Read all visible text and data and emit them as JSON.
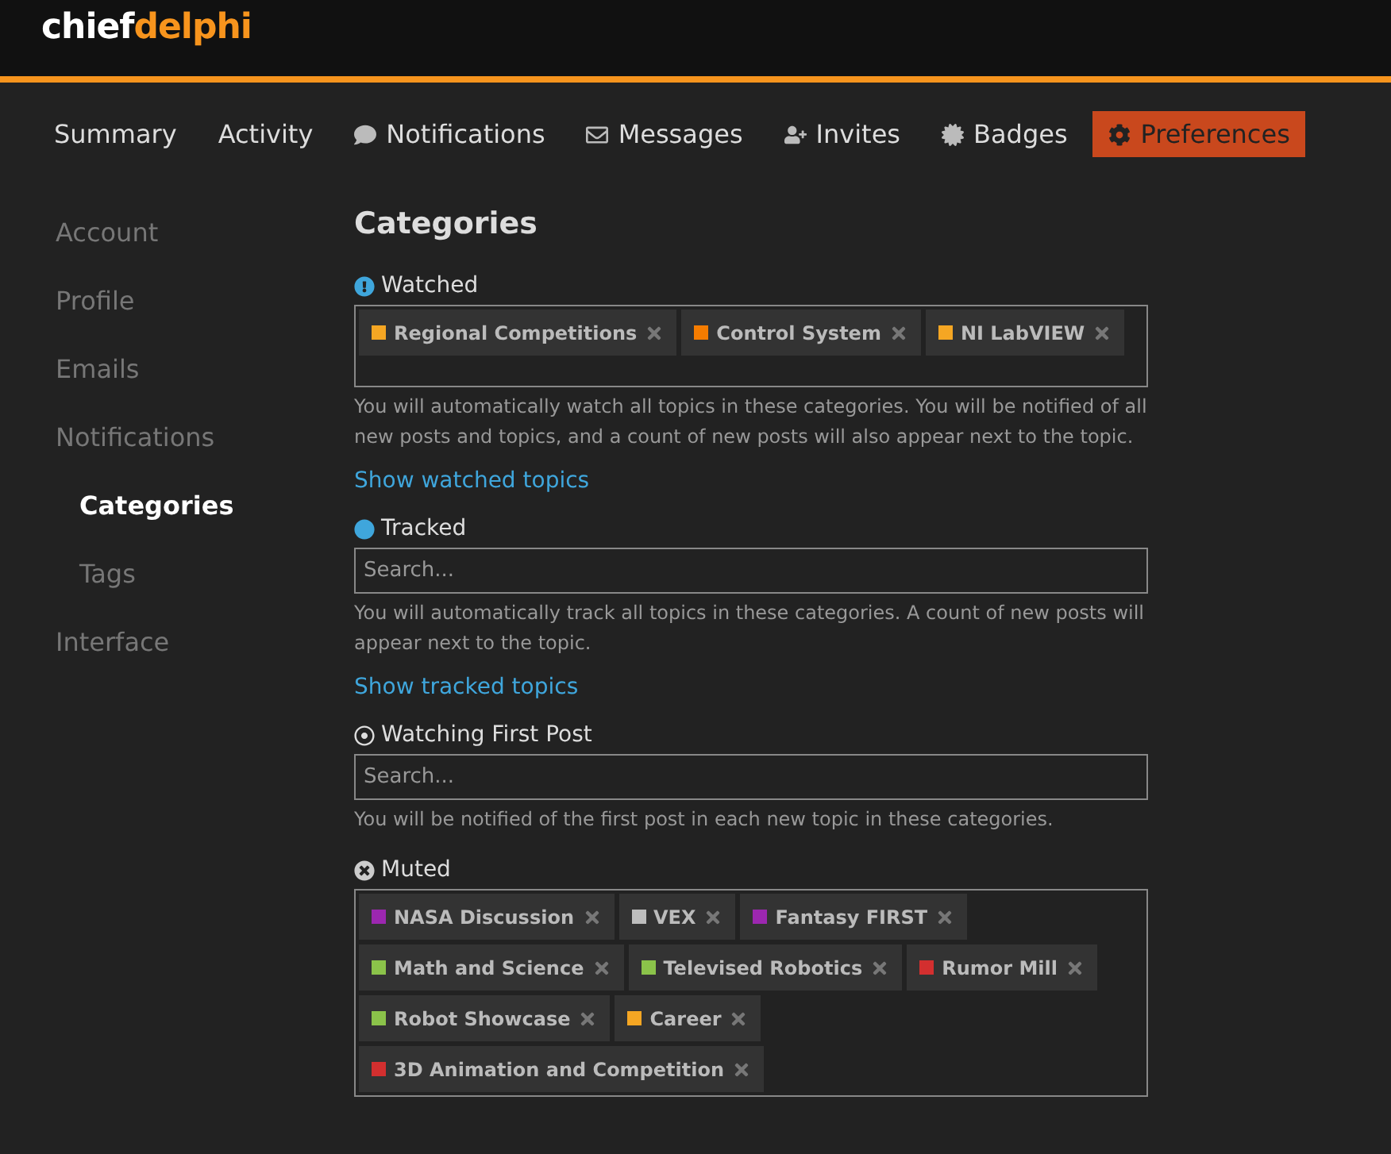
{
  "header": {
    "logo_first": "chief",
    "logo_second": "delphi"
  },
  "tabs": [
    {
      "label": "Summary",
      "selected": false
    },
    {
      "label": "Activity",
      "selected": false
    },
    {
      "label": "Notifications",
      "selected": false
    },
    {
      "label": "Messages",
      "selected": false
    },
    {
      "label": "Invites",
      "selected": false
    },
    {
      "label": "Badges",
      "selected": false
    },
    {
      "label": "Preferences",
      "selected": true
    }
  ],
  "sidebar": {
    "items": [
      {
        "label": "Account",
        "selected": false
      },
      {
        "label": "Profile",
        "selected": false
      },
      {
        "label": "Emails",
        "selected": false
      },
      {
        "label": "Notifications",
        "selected": false,
        "children": [
          {
            "label": "Categories",
            "selected": true
          },
          {
            "label": "Tags",
            "selected": false
          }
        ]
      },
      {
        "label": "Interface",
        "selected": false
      }
    ]
  },
  "title": "Categories",
  "sections": [
    {
      "label": "Watched",
      "tags": [
        {
          "name": "Regional Competitions",
          "color": "#f5a623"
        },
        {
          "name": "Control System",
          "color": "#f57c00"
        },
        {
          "name": "NI LabVIEW",
          "color": "#f5a623"
        }
      ],
      "description": "You will automatically watch all topics in these categories. You will be notified of all new posts and topics, and a count of new posts will also appear next to the topic.",
      "link": "Show watched topics"
    },
    {
      "label": "Tracked",
      "placeholder": "Search...",
      "description": "You will automatically track all topics in these categories. A count of new posts will appear next to the topic.",
      "link": "Show tracked topics"
    },
    {
      "label": "Watching First Post",
      "placeholder": "Search...",
      "description": "You will be notified of the first post in each new topic in these categories."
    },
    {
      "label": "Muted",
      "tags": [
        {
          "name": "NASA Discussion",
          "color": "#9c27b0"
        },
        {
          "name": "VEX",
          "color": "#bdbdbd"
        },
        {
          "name": "Fantasy FIRST",
          "color": "#9c27b0"
        },
        {
          "name": "Math and Science",
          "color": "#8bc34a"
        },
        {
          "name": "Televised Robotics",
          "color": "#8bc34a"
        },
        {
          "name": "Rumor Mill",
          "color": "#d32f2f"
        },
        {
          "name": "Robot Showcase",
          "color": "#8bc34a"
        },
        {
          "name": "Career",
          "color": "#f5a623"
        },
        {
          "name": "3D Animation and Competition",
          "color": "#d32f2f"
        }
      ]
    }
  ]
}
